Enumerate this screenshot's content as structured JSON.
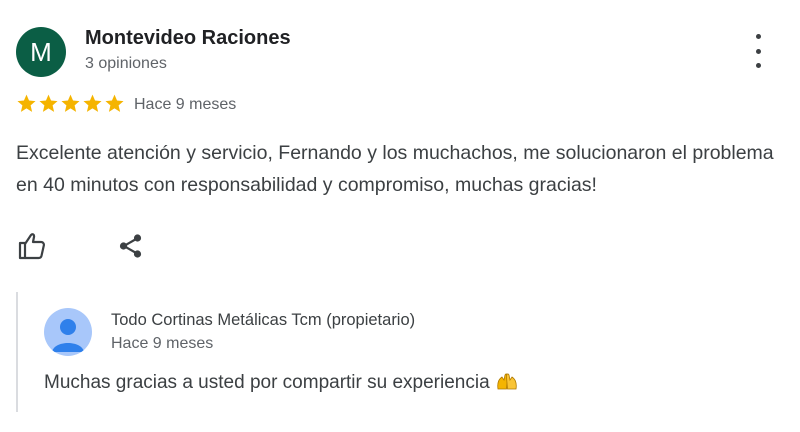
{
  "review": {
    "author": {
      "initial": "M",
      "name": "Montevideo Raciones",
      "meta": "3 opiniones",
      "avatar_color": "#0b5e45"
    },
    "rating": 5,
    "rating_color": "#f5b400",
    "date": "Hace 9 meses",
    "text": "Excelente atención y servicio, Fernando y los muchachos, me solucionaron el problema en 40 minutos con responsabilidad y compromiso, muchas gracias!",
    "actions": {
      "like_icon": "thumb-up-icon",
      "share_icon": "share-icon",
      "more_icon": "more-vert-icon"
    }
  },
  "reply": {
    "owner_name": "Todo Cortinas Metálicas Tcm (propietario)",
    "date": "Hace 9 meses",
    "text": "Muchas gracias a usted por compartir su experiencia",
    "emoji": "raising-hands-emoji"
  }
}
